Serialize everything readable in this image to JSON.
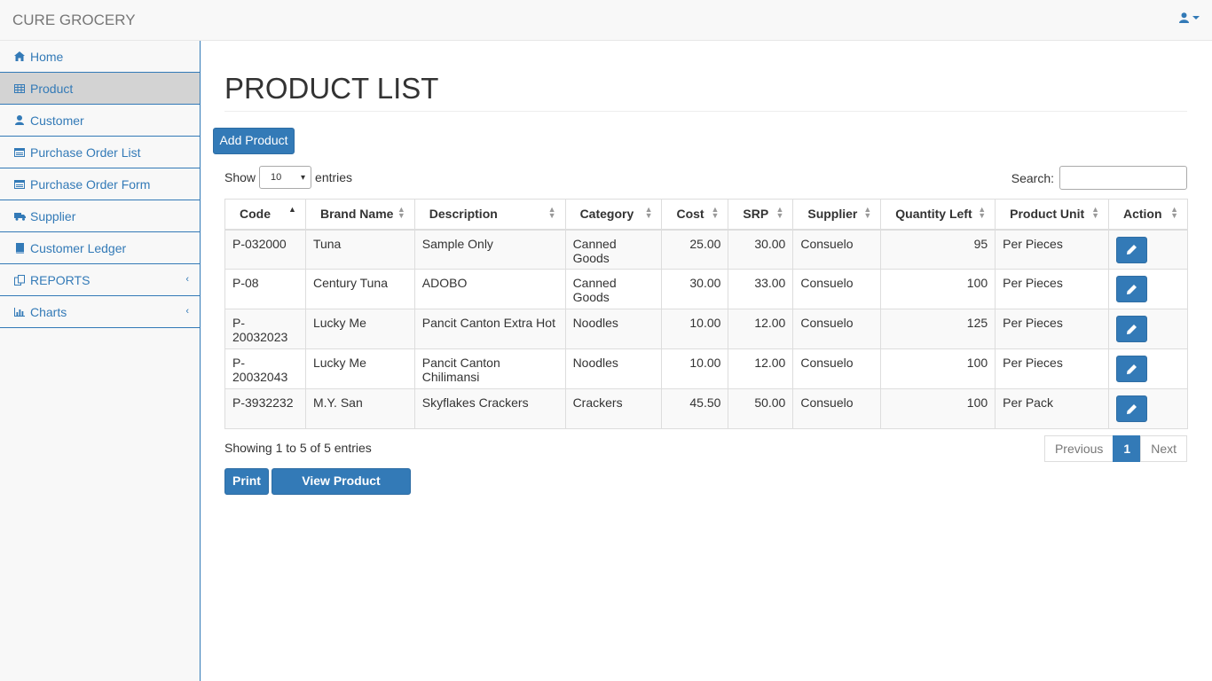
{
  "app": {
    "brand": "CURE GROCERY"
  },
  "sidebar": {
    "items": [
      {
        "label": "Home",
        "icon": "home-icon"
      },
      {
        "label": "Product",
        "icon": "table-icon",
        "active": true
      },
      {
        "label": "Customer",
        "icon": "user-icon"
      },
      {
        "label": "Purchase Order List",
        "icon": "list-icon"
      },
      {
        "label": "Purchase Order Form",
        "icon": "list-icon"
      },
      {
        "label": "Supplier",
        "icon": "truck-icon"
      },
      {
        "label": "Customer Ledger",
        "icon": "book-icon"
      },
      {
        "label": "REPORTS",
        "icon": "files-icon",
        "has_submenu": true
      },
      {
        "label": "Charts",
        "icon": "bar-chart-icon",
        "has_submenu": true
      }
    ]
  },
  "page": {
    "title": "PRODUCT LIST",
    "add_label": "Add Product",
    "show_label": "Show",
    "entries_value": "10",
    "entries_label": "entries",
    "search_label": "Search:",
    "search_value": "",
    "info": "Showing 1 to 5 of 5 entries",
    "pager": {
      "previous": "Previous",
      "current": "1",
      "next": "Next"
    },
    "print_label": "Print",
    "expiration_label": "View Product Expiration"
  },
  "table": {
    "columns": [
      "Code",
      "Brand Name",
      "Description",
      "Category",
      "Cost",
      "SRP",
      "Supplier",
      "Quantity Left",
      "Product Unit",
      "Action"
    ],
    "rows": [
      [
        "P-032000",
        "Tuna",
        "Sample Only",
        "Canned Goods",
        "25.00",
        "30.00",
        "Consuelo",
        "95",
        "Per Pieces"
      ],
      [
        "P-08",
        "Century Tuna",
        "ADOBO",
        "Canned Goods",
        "30.00",
        "33.00",
        "Consuelo",
        "100",
        "Per Pieces"
      ],
      [
        "P-20032023",
        "Lucky Me",
        "Pancit Canton Extra Hot",
        "Noodles",
        "10.00",
        "12.00",
        "Consuelo",
        "125",
        "Per Pieces"
      ],
      [
        "P-20032043",
        "Lucky Me",
        "Pancit Canton Chilimansi",
        "Noodles",
        "10.00",
        "12.00",
        "Consuelo",
        "100",
        "Per Pieces"
      ],
      [
        "P-3932232",
        "M.Y. San",
        "Skyflakes Crackers",
        "Crackers",
        "45.50",
        "50.00",
        "Consuelo",
        "100",
        "Per Pack"
      ]
    ]
  },
  "colors": {
    "primary": "#337ab7",
    "sidebar_bg": "#f8f8f8",
    "active_bg": "#d3d3d3"
  }
}
